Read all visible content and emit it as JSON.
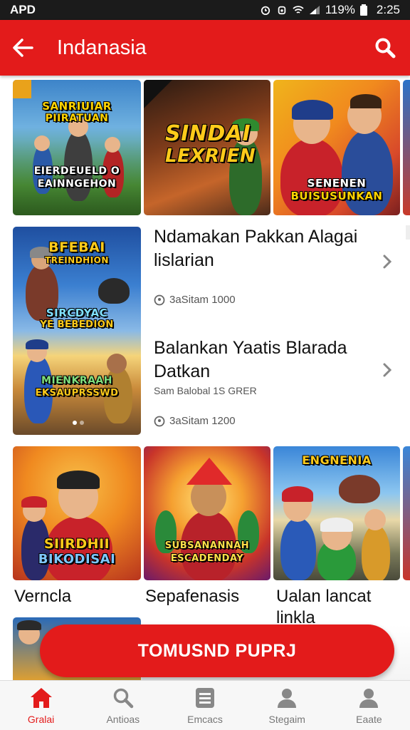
{
  "status_bar": {
    "carrier": "APD",
    "battery": "119%",
    "time": "2:25"
  },
  "app_bar": {
    "title": "Indanasia",
    "back_icon": "arrow-left-icon",
    "search_icon": "search-icon"
  },
  "top_row": [
    {
      "line1": "SANRIUIAR",
      "line2": "PIIRATUAN",
      "line3": "EIERDEUELD O",
      "line4": "EAINNGEHON"
    },
    {
      "line1": "SINDAI",
      "line2": "LEXRIEN"
    },
    {
      "line1": "SENENEN",
      "line2": "BUISUSUNKAN"
    }
  ],
  "feature": {
    "poster": {
      "line1": "BFEBAI",
      "line2": "TREINDHION",
      "line3": "SIRCDYAC",
      "line4": "YE BEBEDION",
      "line5": "MIENKRAAH",
      "line6": "EKSAUPRSSWD"
    },
    "items": [
      {
        "title": "Ndamakan Pakkan Alagai lislarian",
        "subtitle": "",
        "meta": "3aSitam 1000"
      },
      {
        "title": "Balankan Yaatis Blarada Datkan",
        "subtitle": "Sam Balobal 1S GRER",
        "meta": "3aSitam 1200"
      }
    ]
  },
  "bottom_row": [
    {
      "label": "Verncla",
      "line1": "SIIRDHII",
      "line2": "BIKODISAI"
    },
    {
      "label": "Sepafenasis",
      "line1": "SUBSANANNAH",
      "line2": "ESCADENDAY"
    },
    {
      "label": "Ualan lancat linkla",
      "line1": "ENGNENIA",
      "line2": ""
    }
  ],
  "cta": {
    "label": "TOMUSND PUPRJ"
  },
  "bottom_nav": [
    {
      "label": "Gralai",
      "icon": "home-icon",
      "active": true
    },
    {
      "label": "Antioas",
      "icon": "search-icon",
      "active": false
    },
    {
      "label": "Emcacs",
      "icon": "list-icon",
      "active": false
    },
    {
      "label": "Stegaim",
      "icon": "person-icon",
      "active": false
    },
    {
      "label": "Eaate",
      "icon": "profile-icon",
      "active": false
    }
  ],
  "colors": {
    "accent": "#e31b1b",
    "status_bar": "#1b1b1b",
    "nav_bg": "#f7f7f7"
  }
}
